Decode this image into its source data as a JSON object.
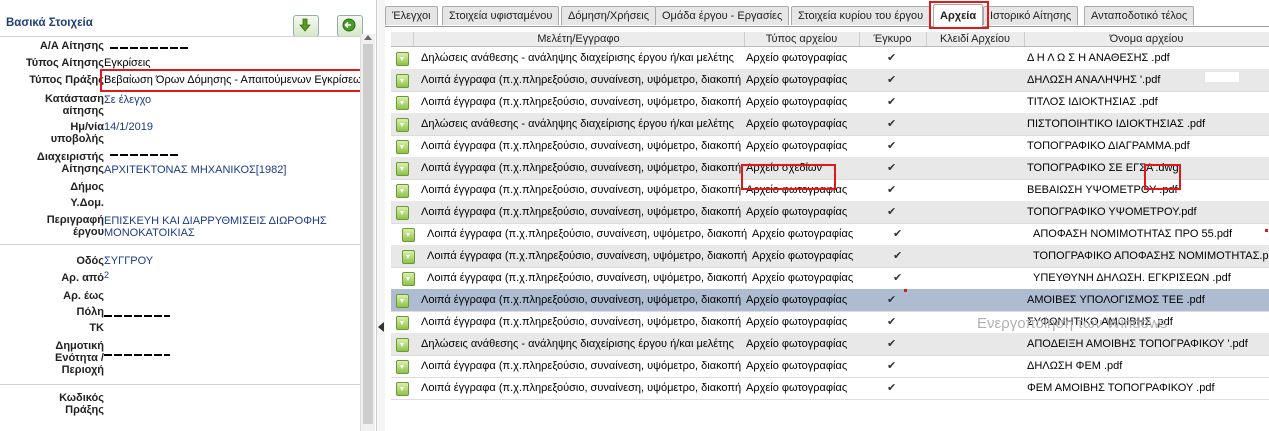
{
  "left": {
    "title": "Βασικά Στοιχεία",
    "fields": [
      {
        "label": "Α/Α Αίτησης",
        "value": ""
      },
      {
        "label": "Τύπος Αίτησης",
        "value": "Εγκρίσεις"
      },
      {
        "label": "Τύπος Πράξης",
        "value": "Βεβαίωση Όρων Δόμησης - Απαιτούμενων Εγκρίσεων"
      },
      {
        "label_lines": [
          "Κατάσταση",
          "αίτησης"
        ],
        "value": "Σε έλεγχο"
      },
      {
        "label_lines": [
          "Ημ/νία",
          "υποβολής"
        ],
        "value": "14/1/2019"
      },
      {
        "label_lines": [
          "Διαχειριστής",
          "Αίτησης"
        ],
        "value": "ΑΡΧΙΤΕΚΤΟΝΑΣ ΜΗΧΑΝΙΚΟΣ[1982]"
      },
      {
        "label": "Δήμος",
        "value": ""
      },
      {
        "label": "Υ.Δομ.",
        "value": ""
      },
      {
        "label_lines": [
          "Περιγραφή",
          "έργου"
        ],
        "value_lines": [
          "ΕΠΙΣΚΕΥΗ ΚΑΙ ΔΙΑΡΡΥΘΜΙΣΕΙΣ ΔΙΩΡΟΦΗΣ",
          "ΜΟΝΟΚΑΤΟΙΚΙΑΣ"
        ]
      },
      {
        "label": "Οδός",
        "value": "ΣΥΓΓΡΟΥ"
      },
      {
        "label": "Αρ. από",
        "value": "2"
      },
      {
        "label": "Αρ. έως",
        "value": ""
      },
      {
        "label": "Πόλη",
        "value": ""
      },
      {
        "label": "ΤΚ",
        "value": ""
      },
      {
        "label_lines": [
          "Δημοτική",
          "Ενότητα /",
          "Περιοχή"
        ],
        "value": ""
      },
      {
        "label_lines": [
          "Κωδικός",
          "Πράξης"
        ],
        "value": ""
      }
    ]
  },
  "tabs": [
    "Έλεγχοι",
    "Στοιχεία υφισταμένου",
    "Δόμηση/Χρήσεις",
    "Ομάδα έργου - Εργασίες",
    "Στοιχεία κυρίου του έργου",
    "Αρχεία",
    "Ιστορικό Αίτησης",
    "Ανταποδοτικό τέλος"
  ],
  "active_tab": "Αρχεία",
  "grid": {
    "headers": [
      "Μελέτη/Εγγραφο",
      "Τύπος αρχείου",
      "Έγκυρο",
      "Κλειδί Αρχείου",
      "Όνομα αρχείου"
    ],
    "rows": [
      {
        "doc": "Δηλώσεις ανάθεσης - ανάληψης διαχείρισης έργου ή/και μελέτης",
        "type": "Αρχείο φωτογραφίας",
        "valid": "✔",
        "key": "",
        "name": "Δ Η Λ Ω Σ Η ΑΝΑΘΕΣΗΣ .pdf"
      },
      {
        "doc": "Λοιπά έγγραφα (π.χ.πληρεξούσιο, συναίνεση, υψόμετρο, διακοπή",
        "type": "Αρχείο φωτογραφίας",
        "valid": "✔",
        "key": "",
        "name": "ΔΗΛΩΣΗ ΑΝΑΛΗΨΗΣ '.pdf"
      },
      {
        "doc": "Λοιπά έγγραφα (π.χ.πληρεξούσιο, συναίνεση, υψόμετρο, διακοπή",
        "type": "Αρχείο φωτογραφίας",
        "valid": "✔",
        "key": "",
        "name": "ΤΙΤΛΟΣ ΙΔΙΟΚΤΗΣΙΑΣ .pdf"
      },
      {
        "doc": "Δηλώσεις ανάθεσης - ανάληψης διαχείρισης έργου ή/και μελέτης",
        "type": "Αρχείο φωτογραφίας",
        "valid": "✔",
        "key": "",
        "name": "ΠΙΣΤΟΠΟΙΗΤΙΚΟ ΙΔΙΟΚΤΗΣΙΑΣ .pdf"
      },
      {
        "doc": "Λοιπά έγγραφα (π.χ.πληρεξούσιο, συναίνεση, υψόμετρο, διακοπή",
        "type": "Αρχείο φωτογραφίας",
        "valid": "✔",
        "key": "",
        "name": "ΤΟΠΟΓΡΑΦΙΚΟ ΔΙΑΓΡΑΜΜΑ.pdf"
      },
      {
        "doc": "Λοιπά έγγραφα (π.χ.πληρεξούσιο, συναίνεση, υψόμετρο, διακοπή",
        "type": "Αρχείο σχεδίων",
        "valid": "✔",
        "key": "",
        "name": "ΤΟΠΟΓΡΑΦΙΚΟ ΣΕ ΕΓΣΑ",
        "ext": ".dwg"
      },
      {
        "doc": "Λοιπά έγγραφα (π.χ.πληρεξούσιο, συναίνεση, υψόμετρο, διακοπή",
        "type": "Αρχείο φωτογραφίας",
        "valid": "✔",
        "key": "",
        "name": "ΒΕΒΑΙΩΣΗ ΥΨΟΜΕΤΡΟΥ .pdf"
      },
      {
        "doc": "Λοιπά έγγραφα (π.χ.πληρεξούσιο, συναίνεση, υψόμετρο, διακοπή",
        "type": "Αρχείο φωτογραφίας",
        "valid": "✔",
        "key": "",
        "name": "ΤΟΠΟΓΡΑΦΙΚΟ ΥΨΟΜΕΤΡΟΥ.pdf"
      },
      {
        "doc": "Λοιπά έγγραφα (π.χ.πληρεξούσιο, συναίνεση, υψόμετρο, διακοπή",
        "type": "Αρχείο φωτογραφίας",
        "valid": "✔",
        "key": "",
        "name": "ΑΠΟΦΑΣΗ ΝΟΜΙΜΟΤΗΤΑΣ ΠΡΟ 55.pdf"
      },
      {
        "doc": "Λοιπά έγγραφα (π.χ.πληρεξούσιο, συναίνεση, υψόμετρο, διακοπή",
        "type": "Αρχείο φωτογραφίας",
        "valid": "✔",
        "key": "",
        "name": "ΤΟΠΟΓΡΑΦΙΚΟ ΑΠΟΦΑΣΗΣ ΝΟΜΙΜΟΤΗΤΑΣ.pdf"
      },
      {
        "doc": "Λοιπά έγγραφα (π.χ.πληρεξούσιο, συναίνεση, υψόμετρο, διακοπή",
        "type": "Αρχείο φωτογραφίας",
        "valid": "✔",
        "key": "",
        "name": "ΥΠΕΥΘΥΝΗ ΔΗΛΩΣΗ. ΕΓΚΡΙΣΕΩΝ .pdf"
      },
      {
        "doc": "Λοιπά έγγραφα (π.χ.πληρεξούσιο, συναίνεση, υψόμετρο, διακοπή",
        "type": "Αρχείο φωτογραφίας",
        "valid": "✔",
        "key": "",
        "name": "ΑΜΟΙΒΕΣ ΥΠΟΛΟΓΙΣΜΟΣ ΤΕΕ .pdf"
      },
      {
        "doc": "Λοιπά έγγραφα (π.χ.πληρεξούσιο, συναίνεση, υψόμετρο, διακοπή",
        "type": "Αρχείο φωτογραφίας",
        "valid": "✔",
        "key": "",
        "name": "ΣΥΦΩΝΗΤΙΚΟ ΑΜΟΙΒΗΣ .pdf"
      },
      {
        "doc": "Δηλώσεις ανάθεσης - ανάληψης διαχείρισης έργου ή/και μελέτης",
        "type": "Αρχείο φωτογραφίας",
        "valid": "✔",
        "key": "",
        "name": "ΑΠΟΔΕΙΞΗ ΑΜΟΙΒΗΣ ΤΟΠΟΓΡΑΦΙΚΟΥ '.pdf"
      },
      {
        "doc": "Λοιπά έγγραφα (π.χ.πληρεξούσιο, συναίνεση, υψόμετρο, διακοπή",
        "type": "Αρχείο φωτογραφίας",
        "valid": "✔",
        "key": "",
        "name": "ΔΗΛΩΣΗ ΦΕΜ .pdf"
      },
      {
        "doc": "Λοιπά έγγραφα (π.χ.πληρεξούσιο, συναίνεση, υψόμετρο, διακοπή",
        "type": "Αρχείο φωτογραφίας",
        "valid": "✔",
        "key": "",
        "name": "ΦΕΜ ΑΜΟΙΒΗΣ ΤΟΠΟΓΡΑΦΙΚΟΥ .pdf"
      }
    ]
  },
  "watermark": "Ενεργοποίηση των Windows",
  "colors": {
    "highlight": "#e01a1a",
    "selected_row": "#aebcd2",
    "alt_row": "#e8e8e8",
    "link_blue": "#1a3a8a"
  },
  "icons": [
    "export-icon",
    "back-icon",
    "document-icon",
    "checkmark-icon"
  ]
}
